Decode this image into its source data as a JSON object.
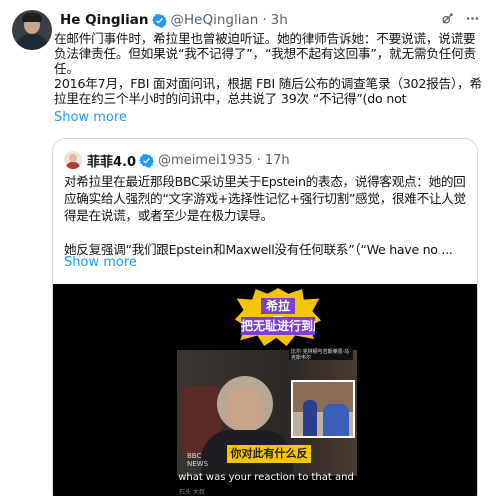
{
  "author": {
    "name": "He Qinglian",
    "handle": "@HeQinglian",
    "dot": "·",
    "time": "3h"
  },
  "icons": {
    "verified": "verified-badge-icon",
    "grok": "grok-icon",
    "more": "more-icon"
  },
  "colors": {
    "verified_blue": "#1d9bf0",
    "link": "#1d9bf0",
    "banner_yellow": "#f5c400",
    "banner_purple": "#7b3fd6"
  },
  "tweet": {
    "lines": [
      "在邮件门事件时，希拉里也曾被迫听证。她的律师告诉她：不要说谎，说谎要",
      "负法律责任。但如果说“我不记得了”，“我想不起有这回事”，就无需负任何责",
      "任。",
      "2016年7月，FBI 面对面问讯，根据 FBI 随后公布的调查笔录（302报告），希",
      "拉里在约三个半小时的问讯中，总共说了 39次 “不记得”(do not"
    ],
    "show_more": "Show more"
  },
  "quote": {
    "name": "菲菲4.0",
    "handle": "@meimei1935",
    "dot": "·",
    "time": "17h",
    "lines": [
      "对希拉里在最近那段BBC采访里关于Epstein的表态，说得客观点：她的回",
      "应确实给人强烈的“文字游戏+选择性记忆+强行切割”感觉，很难不让人觉",
      "得是在说谎，或者至少是在极力误导。",
      "",
      "她反复强调“我们跟Epstein和Maxwell没有任何联系”（“We have no ..."
    ],
    "show_more": "Show more"
  },
  "video": {
    "banner_line1": "希拉里",
    "banner_line2": "把无耻进行到底",
    "inset_caption": "比尔·克林顿与吉斯莱恩·马克斯韦尔",
    "watermark_line1": "BBC",
    "watermark_line2": "NEWS",
    "caption_cn": "你对此有什么反应?",
    "caption_en": "what was your reaction to that and",
    "subline": "石头 大叔"
  }
}
